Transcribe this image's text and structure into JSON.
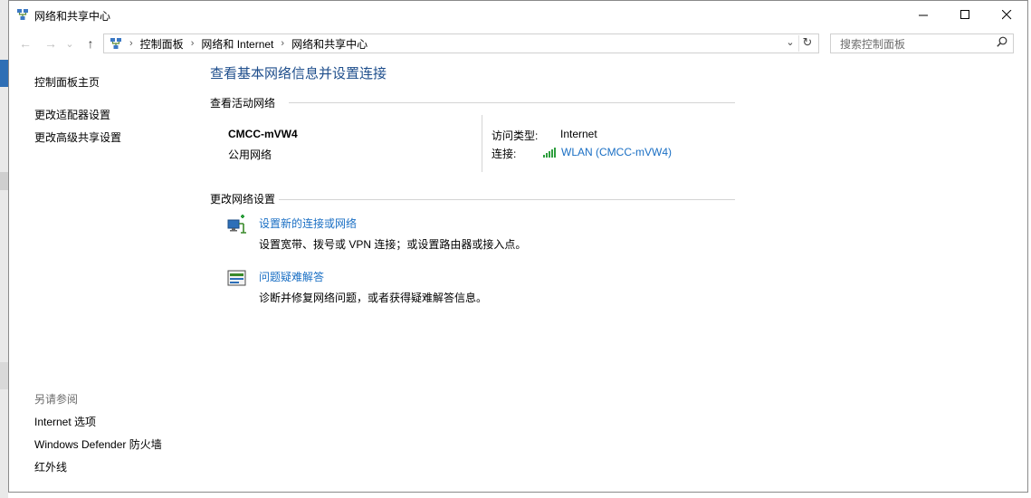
{
  "window": {
    "title": "网络和共享中心",
    "controls": {
      "minimize": "—",
      "maximize": "☐",
      "close": "✕"
    }
  },
  "nav": {
    "back": "←",
    "forward": "→",
    "history": "⌄",
    "up": "↑",
    "breadcrumb": [
      "控制面板",
      "网络和 Internet",
      "网络和共享中心"
    ],
    "separator": "›",
    "dropdown": "⌄",
    "refresh": "↻",
    "search_placeholder": "搜索控制面板",
    "search_glyph": "⚲"
  },
  "sidebar": {
    "home": "控制面板主页",
    "links": [
      "更改适配器设置",
      "更改高级共享设置"
    ],
    "see_also_title": "另请参阅",
    "see_also": [
      "Internet 选项",
      "Windows Defender 防火墙",
      "红外线"
    ]
  },
  "main": {
    "title": "查看基本网络信息并设置连接",
    "active_networks_header": "查看活动网络",
    "network": {
      "name": "CMCC-mVW4",
      "category": "公用网络",
      "access_type_label": "访问类型:",
      "access_type_value": "Internet",
      "connections_label": "连接:",
      "connection_value": "WLAN (CMCC-mVW4)"
    },
    "change_settings_header": "更改网络设置",
    "tasks": [
      {
        "label": "设置新的连接或网络",
        "desc": "设置宽带、拨号或 VPN 连接；或设置路由器或接入点。",
        "icon": "new-connection-icon"
      },
      {
        "label": "问题疑难解答",
        "desc": "诊断并修复网络问题，或者获得疑难解答信息。",
        "icon": "troubleshoot-icon"
      }
    ]
  },
  "colors": {
    "link": "#1a6fc4",
    "title": "#1e4e8c",
    "muted": "#6d6d6d",
    "wifi": "#2e9e3e"
  }
}
